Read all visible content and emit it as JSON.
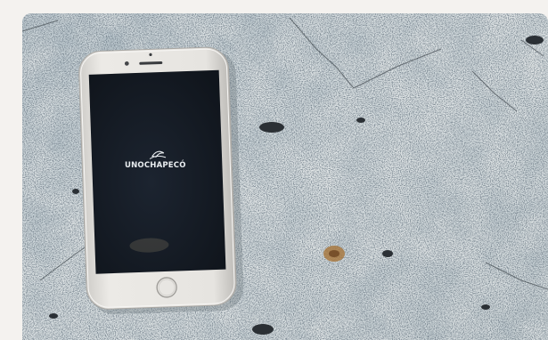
{
  "photo": {
    "description_icon": "smartphone-on-stone-photo",
    "screen_logo_text": "UNOCHAPECÓ",
    "logo_icon": "swoosh-logo-icon"
  },
  "colors": {
    "page_background": "#f4f2ef",
    "stone_base": "#c9d3d8",
    "phone_body": "#e4e2de",
    "phone_screen": "#141b24",
    "logo_text": "#e9edf0"
  }
}
